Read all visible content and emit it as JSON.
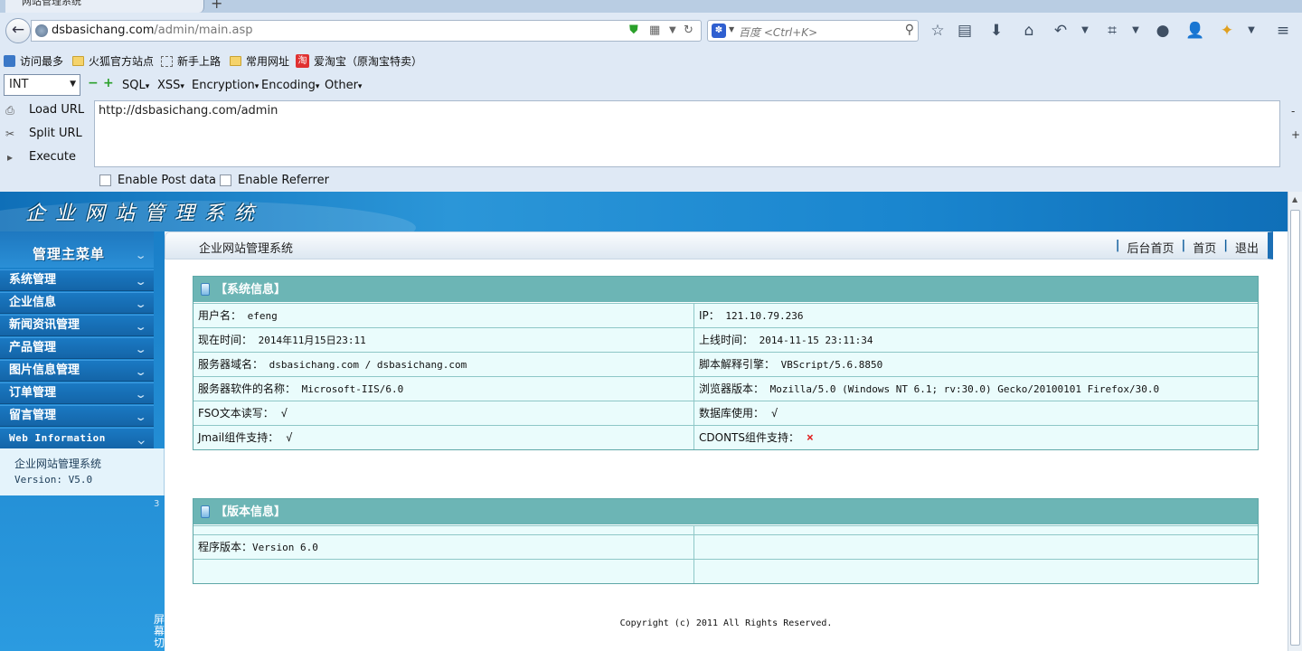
{
  "browser": {
    "tab_title": "网站管理系统",
    "new_tab": "+",
    "url_host": "dsbasichang.com",
    "url_path": "/admin/main.asp",
    "search_placeholder": "百度 <Ctrl+K>",
    "search_engine_icon": "baidu-icon",
    "toolbar_icons": [
      "star-icon",
      "reading-list-icon",
      "download-icon",
      "home-icon",
      "undo-icon",
      "crop-icon",
      "chat-icon",
      "user-icon",
      "addon-icon",
      "menu-icon"
    ]
  },
  "bookmarks": [
    {
      "label": "访问最多",
      "icon": "most-visited-icon"
    },
    {
      "label": "火狐官方站点",
      "icon": "folder-icon"
    },
    {
      "label": "新手上路",
      "icon": "dashed-page-icon"
    },
    {
      "label": "常用网址",
      "icon": "folder-icon"
    },
    {
      "label": "爱淘宝（原淘宝特卖）",
      "icon": "taobao-icon",
      "icon_text": "淘"
    }
  ],
  "hackbar": {
    "select_value": "INT",
    "minus": "−",
    "plus": "+",
    "menus": [
      "SQL",
      "XSS",
      "Encryption",
      "Encoding",
      "Other"
    ],
    "actions": [
      "Load URL",
      "Split URL",
      "Execute"
    ],
    "url_value": "http://dsbasichang.com/admin",
    "side_minus": "-",
    "side_plus": "+",
    "checks": [
      "Enable Post data",
      "Enable Referrer"
    ]
  },
  "site": {
    "title": "企业网站管理系统",
    "menu_title": "管理主菜单",
    "menu_items": [
      "系统管理",
      "企业信息",
      "新闻资讯管理",
      "产品管理",
      "图片信息管理",
      "订单管理",
      "留言管理",
      "Web Information"
    ],
    "info_name": "企业网站管理系统",
    "info_version": "Version: V5.0",
    "page_marker": "3",
    "toggle_label": "屏幕切",
    "crumb_title": "企业网站管理系统",
    "crumb_links": [
      "后台首页",
      "首页",
      "退出"
    ],
    "sys_panel": {
      "title": "【系统信息】",
      "rows": [
        [
          {
            "label": "用户名：",
            "value": "efeng"
          },
          {
            "label": "IP：",
            "value": "121.10.79.236"
          }
        ],
        [
          {
            "label": "现在时间：",
            "value": "2014年11月15日23:11"
          },
          {
            "label": "上线时间：",
            "value": "2014-11-15 23:11:34"
          }
        ],
        [
          {
            "label": "服务器域名：",
            "value": "dsbasichang.com / dsbasichang.com"
          },
          {
            "label": "脚本解释引擎：",
            "value": "VBScript/5.6.8850"
          }
        ],
        [
          {
            "label": "服务器软件的名称：",
            "value": "Microsoft-IIS/6.0"
          },
          {
            "label": "浏览器版本：",
            "value": "Mozilla/5.0 (Windows NT 6.1; rv:30.0) Gecko/20100101 Firefox/30.0"
          }
        ],
        [
          {
            "label": "FSO文本读写：",
            "mark": "√"
          },
          {
            "label": "数据库使用：",
            "mark": "√"
          }
        ],
        [
          {
            "label": "Jmail组件支持：",
            "mark": "√"
          },
          {
            "label": "CDONTS组件支持：",
            "cross": "×"
          }
        ]
      ]
    },
    "ver_panel": {
      "title": "【版本信息】",
      "row_label": "程序版本：",
      "row_value": "Version 6.0"
    },
    "copyright": "Copyright (c) 2011 All Rights Reserved."
  }
}
